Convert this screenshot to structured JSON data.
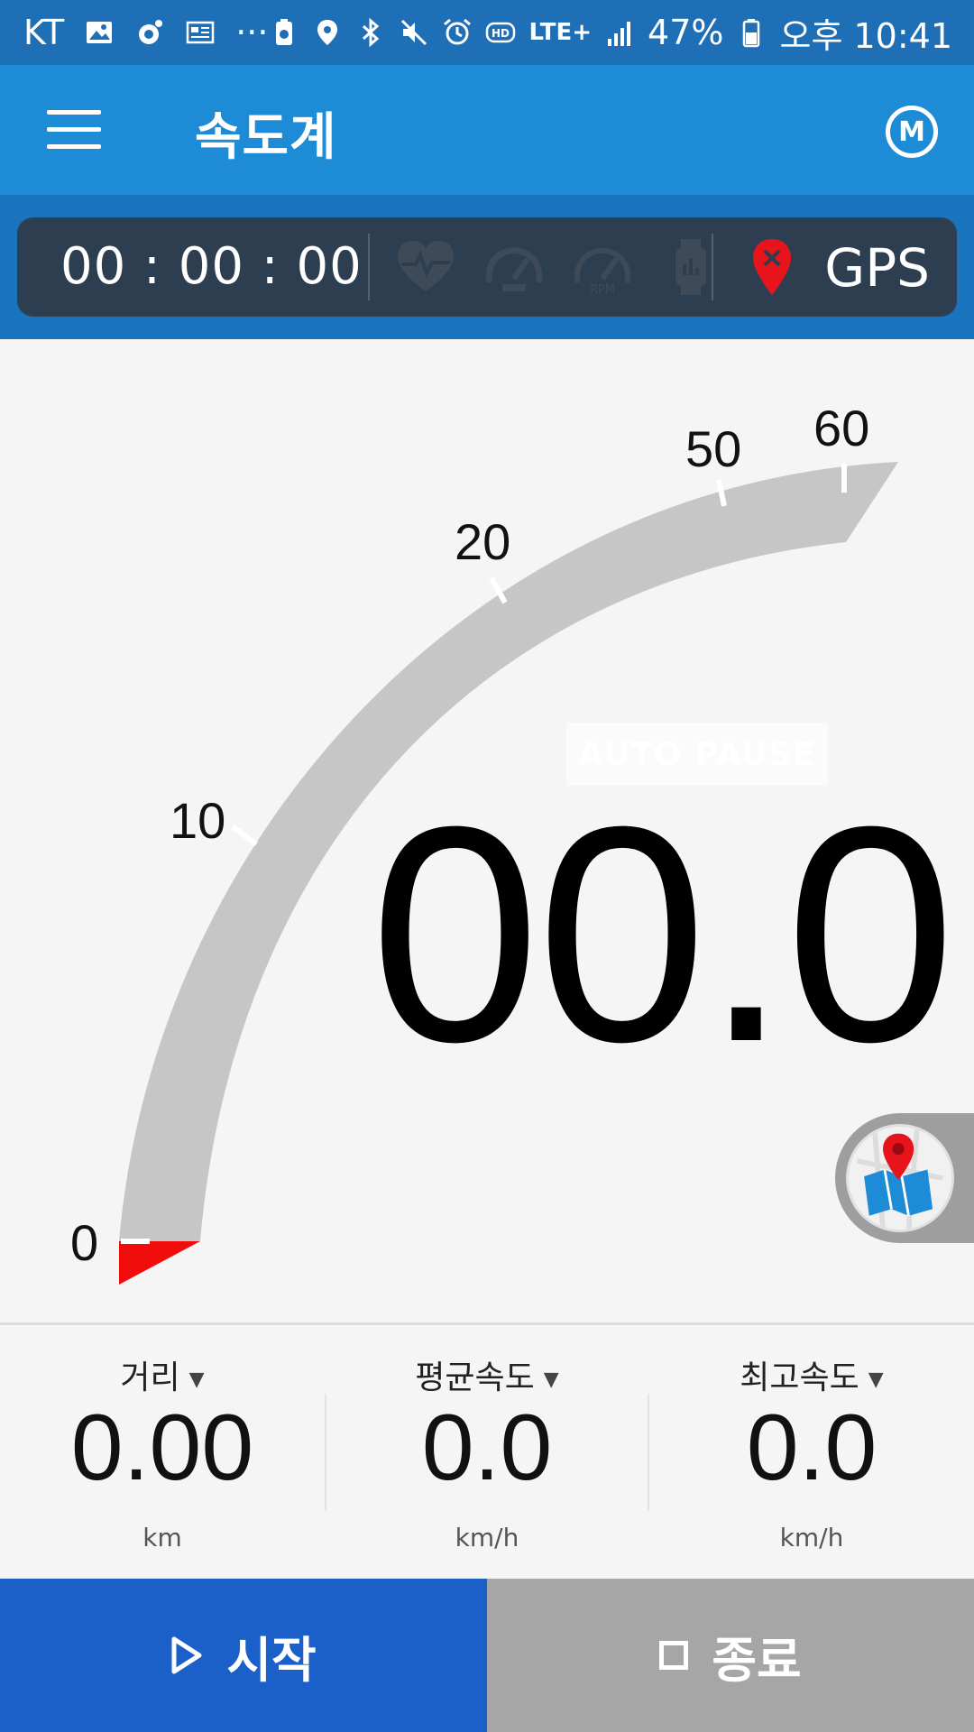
{
  "status_bar": {
    "carrier": "KT",
    "overflow": "···",
    "network": "LTE+",
    "battery": "47%",
    "time": "오후 10:41",
    "icons": [
      "gallery-icon",
      "camera-icon",
      "news-icon",
      "battery-saver-icon",
      "location-icon",
      "bluetooth-icon",
      "mute-icon",
      "alarm-icon",
      "hd-voice-icon",
      "signal-icon",
      "battery-icon"
    ]
  },
  "app_bar": {
    "title": "속도계",
    "menu_icon": "hamburger-menu-icon",
    "right_icon": "m-logo-icon",
    "right_icon_text": "M"
  },
  "info_panel": {
    "timer": "00 : 00 : 00",
    "sensor_icons": [
      "heart-rate-icon",
      "speedometer-icon",
      "rpm-icon",
      "smartwatch-icon"
    ],
    "rpm_label": "RPM",
    "gps_label": "GPS",
    "gps_status_color": "#e8141b"
  },
  "gauge": {
    "value": 0,
    "max": 60,
    "ticks": [
      {
        "label": "0",
        "value": 0
      },
      {
        "label": "10",
        "value": 10
      },
      {
        "label": "20",
        "value": 20
      },
      {
        "label": "50",
        "value": 50
      },
      {
        "label": "60",
        "value": 60
      }
    ],
    "arc_color": "#c6c6c6",
    "needle_color": "#f20d0d"
  },
  "speed": {
    "auto_pause": "AUTO PAUSE",
    "value": "00.0"
  },
  "stats": [
    {
      "label": "거리",
      "value": "0.00",
      "unit": "km"
    },
    {
      "label": "평균속도",
      "value": "0.0",
      "unit": "km/h"
    },
    {
      "label": "최고속도",
      "value": "0.0",
      "unit": "km/h"
    }
  ],
  "buttons": {
    "start": "시작",
    "stop": "종료",
    "start_color": "#1b5fc9",
    "stop_color": "#a6a6a6"
  }
}
